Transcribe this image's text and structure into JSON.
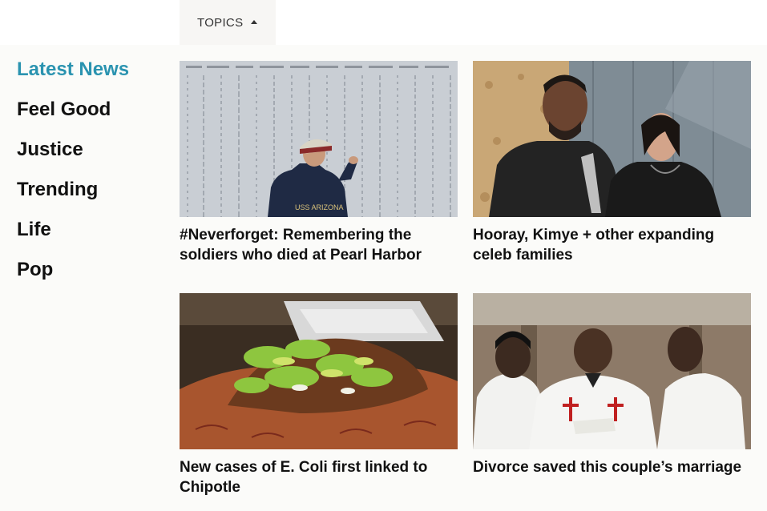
{
  "header": {
    "topics_label": "TOPICS"
  },
  "sidebar": {
    "items": [
      {
        "label": "Latest News",
        "active": true
      },
      {
        "label": "Feel Good"
      },
      {
        "label": "Justice"
      },
      {
        "label": "Trending"
      },
      {
        "label": "Life"
      },
      {
        "label": "Pop"
      }
    ]
  },
  "cards": [
    {
      "title": "#Neverforget: Remembering the soldiers who died at Pearl Harbor",
      "image_text": "USS ARIZONA"
    },
    {
      "title": "Hooray, Kimye + other expanding celeb families"
    },
    {
      "title": "New cases of E. Coli first linked to Chipotle"
    },
    {
      "title": "Divorce saved this couple’s marriage"
    }
  ],
  "colors": {
    "accent": "#2a93b0",
    "text": "#111111",
    "panel_bg": "#fbfbf9",
    "topics_bg": "#f7f6f4"
  }
}
